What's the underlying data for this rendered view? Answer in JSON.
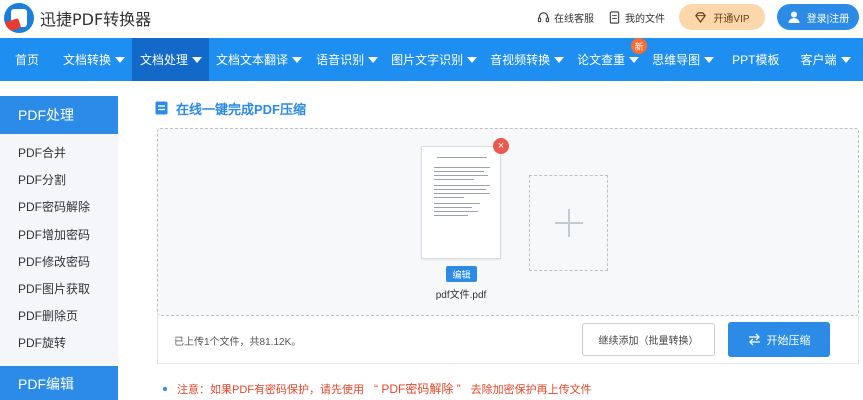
{
  "header": {
    "app_title": "迅捷PDF转换器",
    "service_label": "在线客服",
    "my_files_label": "我的文件",
    "vip_label": "开通VIP",
    "login_label": "登录|注册"
  },
  "nav": {
    "items": [
      {
        "label": "首页",
        "dropdown": false
      },
      {
        "label": "文档转换",
        "dropdown": true
      },
      {
        "label": "文档处理",
        "dropdown": true,
        "active": true
      },
      {
        "label": "文档文本翻译",
        "dropdown": true
      },
      {
        "label": "语音识别",
        "dropdown": true
      },
      {
        "label": "图片文字识别",
        "dropdown": true
      },
      {
        "label": "音视频转换",
        "dropdown": true
      },
      {
        "label": "论文查重",
        "dropdown": true,
        "badge": "新"
      },
      {
        "label": "思维导图",
        "dropdown": true
      },
      {
        "label": "PPT模板",
        "dropdown": false
      },
      {
        "label": "客户端",
        "dropdown": true
      }
    ]
  },
  "sidebar": {
    "section1_title": "PDF处理",
    "items": [
      "PDF合并",
      "PDF分割",
      "PDF密码解除",
      "PDF增加密码",
      "PDF修改密码",
      "PDF图片获取",
      "PDF删除页",
      "PDF旋转"
    ],
    "section2_title": "PDF编辑"
  },
  "main": {
    "title": "在线一键完成PDF压缩",
    "file": {
      "name": "pdf文件.pdf",
      "edit_label": "编辑",
      "delete_symbol": "×"
    },
    "status_text": "已上传1个文件，共81.12K。",
    "continue_label": "继续添加（批量转换）",
    "start_label": "开始压缩",
    "notice_prefix": "注意：如果PDF有密码保护，请先使用",
    "notice_link": "“ PDF密码解除 ”",
    "notice_suffix": "去除加密保护再上传文件"
  },
  "colors": {
    "brand_blue": "#1e8ff0",
    "active_nav": "#1269c7",
    "button_blue": "#2b8be6",
    "vip_bg": "#fbd7ab",
    "notice_red": "#e8462a",
    "badge_orange": "#ff6a2b"
  }
}
